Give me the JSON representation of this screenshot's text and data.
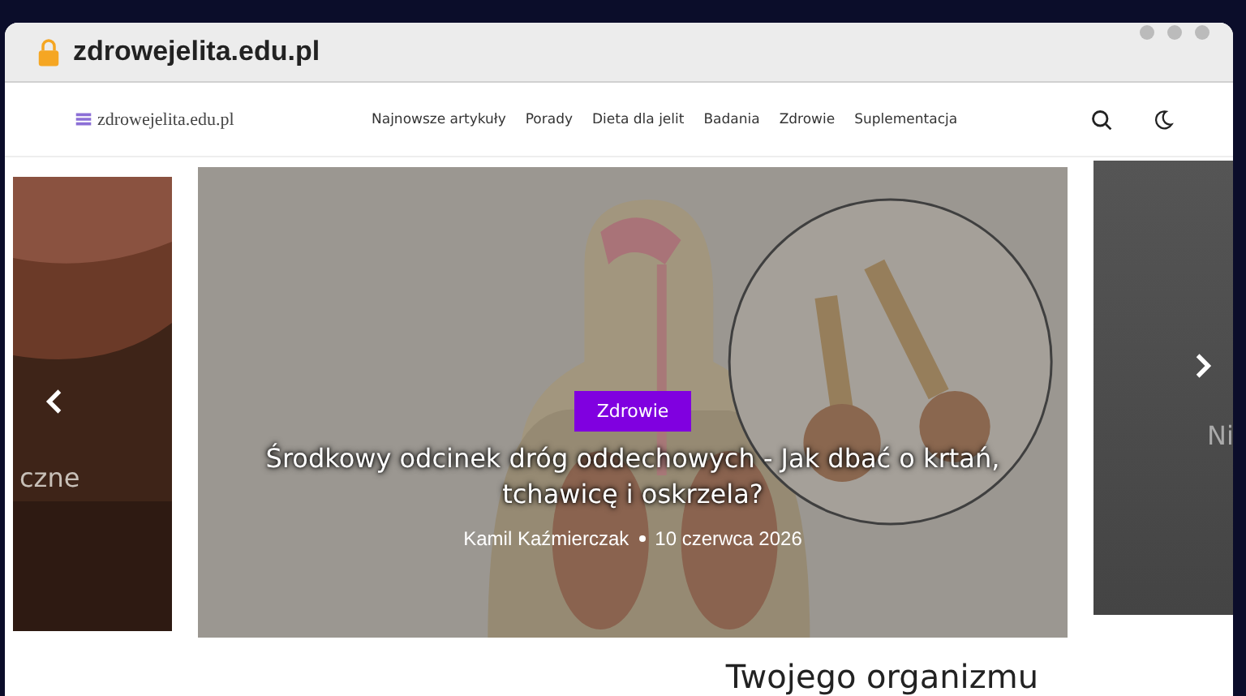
{
  "browser": {
    "url": "zdrowejelita.edu.pl"
  },
  "header": {
    "logo": "zdrowejelita.edu.pl",
    "nav": [
      "Najnowsze artykuły",
      "Porady",
      "Dieta dla jelit",
      "Badania",
      "Zdrowie",
      "Suplementacja"
    ]
  },
  "carousel": {
    "prev_slide": {
      "title_fragment": "czne"
    },
    "main_slide": {
      "category": "Zdrowie",
      "title": "Środkowy odcinek dróg oddechowych - Jak dbać o krtań, tchawicę i oskrzela?",
      "author": "Kamil Kaźmierczak",
      "date": "10 czerwca 2026"
    },
    "next_slide": {
      "title_fragment": "Ni"
    }
  },
  "section_heading": "Twojego organizmu"
}
